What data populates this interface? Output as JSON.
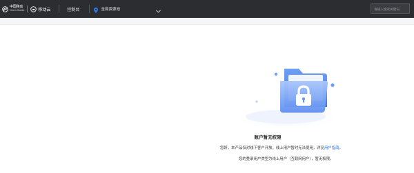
{
  "header": {
    "brand_cn": "中国移动",
    "brand_en": "China Mobile",
    "product_name": "移动云",
    "console_label": "控制台",
    "region_label": "全局资源池",
    "search_placeholder": "请输入搜索关键词",
    "icons": [
      "china-mobile-logo-icon",
      "cloud-logo-icon",
      "location-pin-icon",
      "chevron-down-icon"
    ]
  },
  "empty_state": {
    "title": "账户暂无权限",
    "description_prefix": "您好，本产品仅对线下客户开放，线上用户暂时无法使用，详见",
    "guide_link": "用户指南",
    "description_suffix": "。",
    "note": "您的登录用户类型为线上用户（互联网用户），暂无权限。",
    "icon": "locked-folder-icon"
  },
  "colors": {
    "header_bg": "#2b2d30",
    "link": "#2d6ee6",
    "illustration_blue": "#4d86f0"
  }
}
